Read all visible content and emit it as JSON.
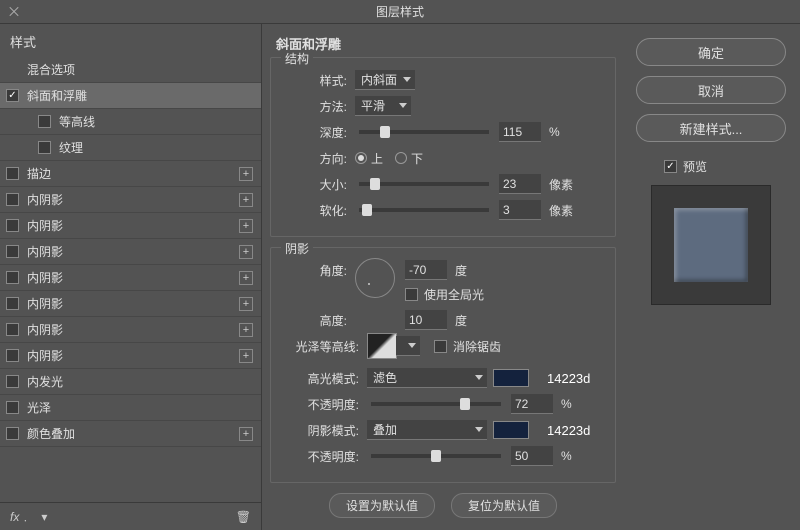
{
  "title": "图层样式",
  "sidebar": {
    "header": "样式",
    "items": [
      {
        "label": "混合选项",
        "hasCheck": false,
        "checked": false,
        "hasAdd": false,
        "sub": false,
        "selected": false
      },
      {
        "label": "斜面和浮雕",
        "hasCheck": true,
        "checked": true,
        "hasAdd": false,
        "sub": false,
        "selected": true
      },
      {
        "label": "等高线",
        "hasCheck": true,
        "checked": false,
        "hasAdd": false,
        "sub": true,
        "selected": false
      },
      {
        "label": "纹理",
        "hasCheck": true,
        "checked": false,
        "hasAdd": false,
        "sub": true,
        "selected": false
      },
      {
        "label": "描边",
        "hasCheck": true,
        "checked": false,
        "hasAdd": true,
        "sub": false,
        "selected": false
      },
      {
        "label": "内阴影",
        "hasCheck": true,
        "checked": false,
        "hasAdd": true,
        "sub": false,
        "selected": false
      },
      {
        "label": "内阴影",
        "hasCheck": true,
        "checked": false,
        "hasAdd": true,
        "sub": false,
        "selected": false
      },
      {
        "label": "内阴影",
        "hasCheck": true,
        "checked": false,
        "hasAdd": true,
        "sub": false,
        "selected": false
      },
      {
        "label": "内阴影",
        "hasCheck": true,
        "checked": false,
        "hasAdd": true,
        "sub": false,
        "selected": false
      },
      {
        "label": "内阴影",
        "hasCheck": true,
        "checked": false,
        "hasAdd": true,
        "sub": false,
        "selected": false
      },
      {
        "label": "内阴影",
        "hasCheck": true,
        "checked": false,
        "hasAdd": true,
        "sub": false,
        "selected": false
      },
      {
        "label": "内阴影",
        "hasCheck": true,
        "checked": false,
        "hasAdd": true,
        "sub": false,
        "selected": false
      },
      {
        "label": "内发光",
        "hasCheck": true,
        "checked": false,
        "hasAdd": false,
        "sub": false,
        "selected": false
      },
      {
        "label": "光泽",
        "hasCheck": true,
        "checked": false,
        "hasAdd": false,
        "sub": false,
        "selected": false
      },
      {
        "label": "颜色叠加",
        "hasCheck": true,
        "checked": false,
        "hasAdd": true,
        "sub": false,
        "selected": false
      }
    ],
    "footer": {
      "fx": "fx"
    }
  },
  "panel": {
    "title": "斜面和浮雕",
    "structure": {
      "group_title": "结构",
      "style_label": "样式:",
      "style_value": "内斜面",
      "technique_label": "方法:",
      "technique_value": "平滑",
      "depth_label": "深度:",
      "depth_value": "115",
      "depth_unit": "%",
      "direction_label": "方向:",
      "up": "上",
      "down": "下",
      "size_label": "大小:",
      "size_value": "23",
      "size_unit": "像素",
      "soften_label": "软化:",
      "soften_value": "3",
      "soften_unit": "像素"
    },
    "shading": {
      "group_title": "阴影",
      "angle_label": "角度:",
      "angle_value": "-70",
      "angle_unit": "度",
      "global_label": "使用全局光",
      "altitude_label": "高度:",
      "altitude_value": "10",
      "altitude_unit": "度",
      "gloss_label": "光泽等高线:",
      "antialias_label": "消除锯齿",
      "highlight_mode_label": "高光模式:",
      "highlight_mode_value": "滤色",
      "highlight_color_hex": "14223d",
      "highlight_opacity_label": "不透明度:",
      "highlight_opacity_value": "72",
      "opacity_unit": "%",
      "shadow_mode_label": "阴影模式:",
      "shadow_mode_value": "叠加",
      "shadow_color_hex": "14223d",
      "shadow_opacity_label": "不透明度:",
      "shadow_opacity_value": "50"
    },
    "buttons": {
      "default": "设置为默认值",
      "reset": "复位为默认值"
    }
  },
  "right": {
    "ok": "确定",
    "cancel": "取消",
    "new_style": "新建样式...",
    "preview": "预览"
  }
}
